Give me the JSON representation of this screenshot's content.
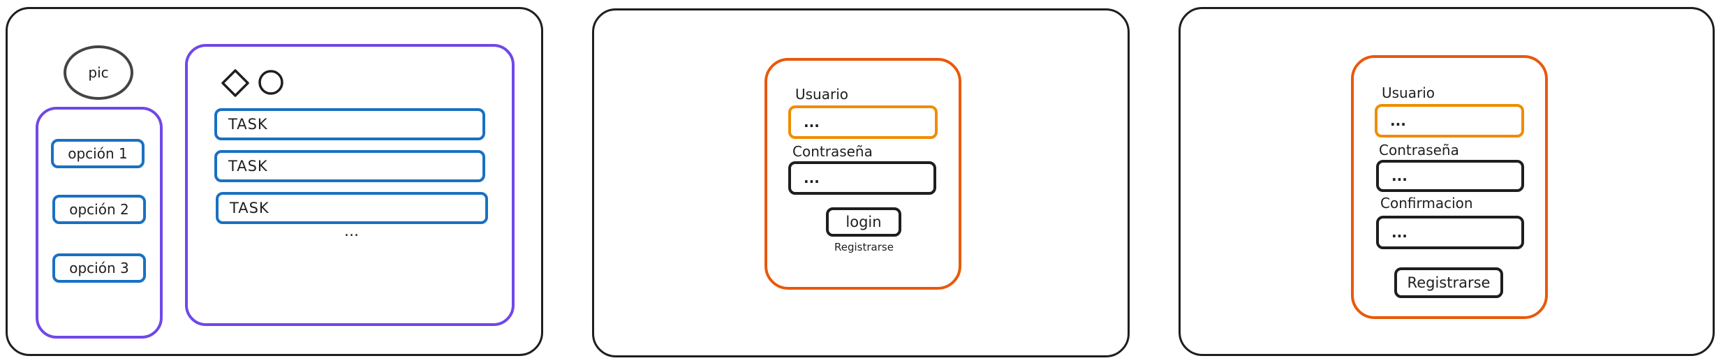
{
  "dashboard": {
    "avatar_label": "pic",
    "menu": [
      {
        "label": "opción 1"
      },
      {
        "label": "opción 2"
      },
      {
        "label": "opción 3"
      }
    ],
    "tasks": [
      {
        "label": "TASK"
      },
      {
        "label": "TASK"
      },
      {
        "label": "TASK"
      }
    ],
    "more_label": "..."
  },
  "login": {
    "user_label": "Usuario",
    "user_value": "...",
    "password_label": "Contraseña",
    "password_value": "...",
    "login_button": "login",
    "register_link": "Registrarse"
  },
  "register": {
    "user_label": "Usuario",
    "user_value": "...",
    "password_label": "Contraseña",
    "password_value": "...",
    "confirm_label": "Confirmacion",
    "confirm_value": "...",
    "register_button": "Registrarse"
  },
  "colors": {
    "stroke": "#1e1e1e",
    "purple": "#7048e8",
    "blue": "#1971c2",
    "orange_container": "#e8590c",
    "orange_field": "#f08c00"
  }
}
